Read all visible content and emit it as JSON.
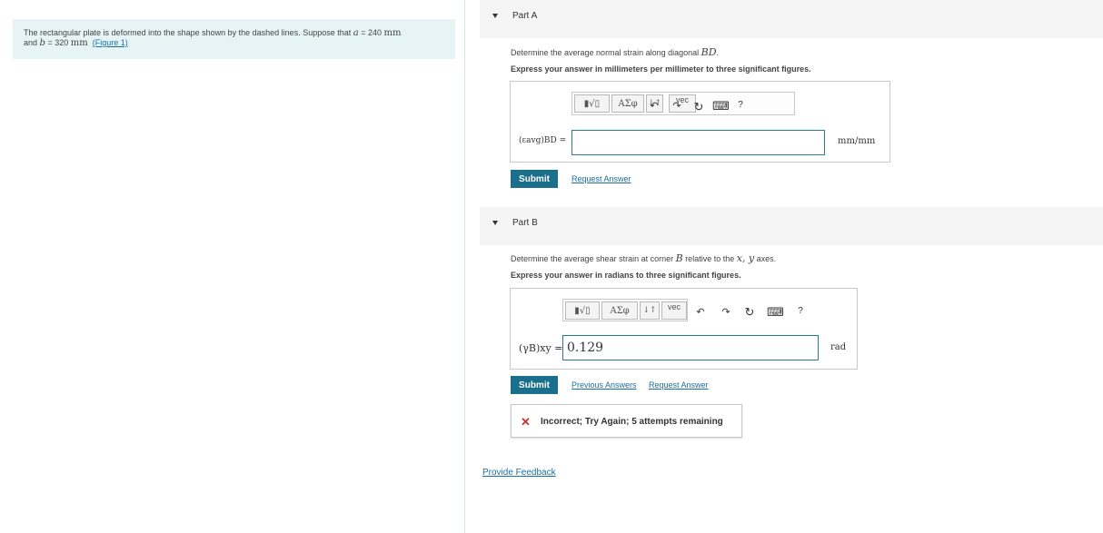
{
  "problem": {
    "text_1": "The rectangular plate is deformed into the shape shown by the dashed lines. Suppose that ",
    "a_var": "a",
    "eq_1": " = 240 ",
    "unit_1": "mm",
    "text_2": "and ",
    "b_var": "b",
    "eq_2": " = 320 ",
    "unit_2": "mm",
    "figure_link": "(Figure 1)"
  },
  "part_a": {
    "title": "Part A",
    "prompt_text": "Determine the average normal strain along diagonal ",
    "prompt_var": "BD",
    "prompt_end": ".",
    "instruction": "Express your answer in millimeters per millimeter to three significant figures.",
    "label": "(εavg)BD =",
    "input_value": "",
    "unit": "mm/mm",
    "submit_label": "Submit",
    "request_answer": "Request Answer"
  },
  "part_b": {
    "title": "Part B",
    "prompt_text": "Determine the average shear strain at corner ",
    "prompt_var": "B",
    "prompt_mid": " relative to the ",
    "prompt_axes": "x, y",
    "prompt_end": " axes.",
    "instruction": "Express your answer in radians to three significant figures.",
    "label": "(γB)xy =",
    "input_value": "0.129",
    "unit": "rad",
    "submit_label": "Submit",
    "previous_answers": "Previous Answers",
    "request_answer": "Request Answer",
    "feedback_icon": "x-icon",
    "feedback": "Incorrect; Try Again; 5 attempts remaining"
  },
  "toolbar": {
    "templates": "▮√▯",
    "greek": "ΑΣφ",
    "arrows": "↓↑",
    "vec": "vec",
    "undo": "↶",
    "redo": "↷",
    "reset": "↻",
    "keyboard": "⌨",
    "help": "?"
  },
  "provide_feedback": "Provide Feedback"
}
